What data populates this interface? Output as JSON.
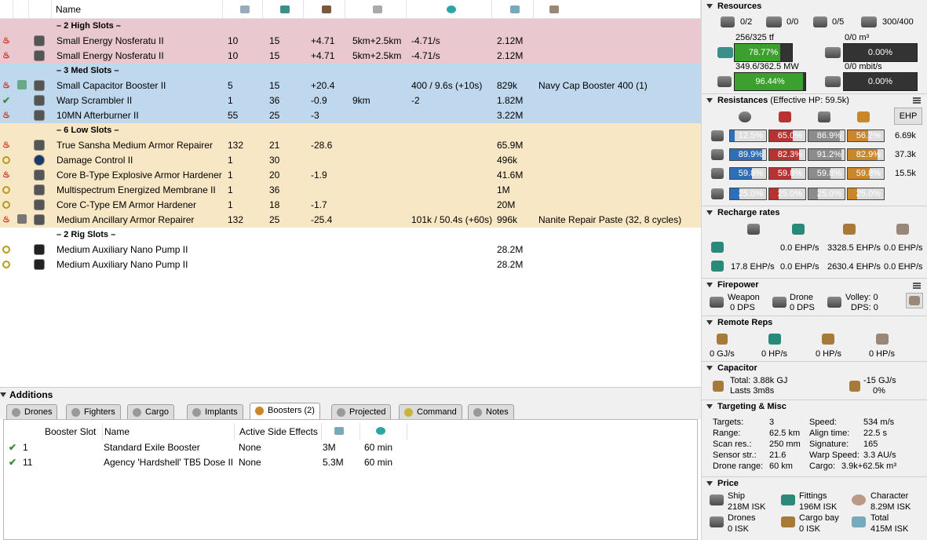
{
  "fitting": {
    "columns": {
      "name": "Name"
    },
    "sections": [
      {
        "kind": "high",
        "title": "– 2 High Slots –"
      },
      {
        "kind": "med",
        "title": "– 3 Med Slots –"
      },
      {
        "kind": "low",
        "title": "– 6 Low Slots –"
      },
      {
        "kind": "rig",
        "title": "– 2 Rig Slots –"
      }
    ],
    "rows": [
      {
        "name": "Small Energy Nosferatu II",
        "c1": "10",
        "c2": "15",
        "c3": "+4.71",
        "c4": "5km+2.5km",
        "c5": "-4.71/s",
        "c6": "2.12M",
        "c7": ""
      },
      {
        "name": "Small Energy Nosferatu II",
        "c1": "10",
        "c2": "15",
        "c3": "+4.71",
        "c4": "5km+2.5km",
        "c5": "-4.71/s",
        "c6": "2.12M",
        "c7": ""
      },
      {
        "name": "Small Capacitor Booster II",
        "c1": "5",
        "c2": "15",
        "c3": "+20.4",
        "c4": "",
        "c5": "400 / 9.6s (+10s)",
        "c6": "829k",
        "c7": "Navy Cap Booster 400 (1)"
      },
      {
        "name": "Warp Scrambler II",
        "c1": "1",
        "c2": "36",
        "c3": "-0.9",
        "c4": "9km",
        "c5": "-2",
        "c6": "1.82M",
        "c7": ""
      },
      {
        "name": "10MN Afterburner II",
        "c1": "55",
        "c2": "25",
        "c3": "-3",
        "c4": "",
        "c5": "",
        "c6": "3.22M",
        "c7": ""
      },
      {
        "name": "True Sansha Medium Armor Repairer",
        "c1": "132",
        "c2": "21",
        "c3": "-28.6",
        "c4": "",
        "c5": "",
        "c6": "65.9M",
        "c7": ""
      },
      {
        "name": "Damage Control II",
        "c1": "1",
        "c2": "30",
        "c3": "",
        "c4": "",
        "c5": "",
        "c6": "496k",
        "c7": ""
      },
      {
        "name": "Core B-Type Explosive Armor Hardener",
        "c1": "1",
        "c2": "20",
        "c3": "-1.9",
        "c4": "",
        "c5": "",
        "c6": "41.6M",
        "c7": ""
      },
      {
        "name": "Multispectrum Energized Membrane II",
        "c1": "1",
        "c2": "36",
        "c3": "",
        "c4": "",
        "c5": "",
        "c6": "1M",
        "c7": ""
      },
      {
        "name": "Core C-Type EM Armor Hardener",
        "c1": "1",
        "c2": "18",
        "c3": "-1.7",
        "c4": "",
        "c5": "",
        "c6": "20M",
        "c7": ""
      },
      {
        "name": "Medium Ancillary Armor Repairer",
        "c1": "132",
        "c2": "25",
        "c3": "-25.4",
        "c4": "",
        "c5": "101k / 50.4s (+60s)",
        "c6": "996k",
        "c7": "Nanite Repair Paste (32, 8 cycles)"
      },
      {
        "name": "Medium Auxiliary Nano Pump II",
        "c1": "",
        "c2": "",
        "c3": "",
        "c4": "",
        "c5": "",
        "c6": "28.2M",
        "c7": ""
      },
      {
        "name": "Medium Auxiliary Nano Pump II",
        "c1": "",
        "c2": "",
        "c3": "",
        "c4": "",
        "c5": "",
        "c6": "28.2M",
        "c7": ""
      }
    ]
  },
  "additions": {
    "title": "Additions",
    "tabs": [
      "Drones",
      "Fighters",
      "Cargo",
      "Implants",
      "Boosters (2)",
      "Projected",
      "Command",
      "Notes"
    ],
    "headers": [
      "Booster Slot",
      "Name",
      "Active Side Effects"
    ],
    "rows": [
      {
        "slot": "1",
        "name": "Standard Exile Booster",
        "effects": "None",
        "price": "3M",
        "duration": "60 min"
      },
      {
        "slot": "11",
        "name": "Agency 'Hardshell' TB5 Dose II",
        "effects": "None",
        "price": "5.3M",
        "duration": "60 min"
      }
    ]
  },
  "resources": {
    "title": "Resources",
    "hardpoints": [
      "0/2",
      "0/0",
      "0/5",
      "300/400"
    ],
    "cpu_text": "256/325 tf",
    "cpu_pct": "78.77%",
    "cpu_fill": 0.7877,
    "drone_bay": "0/0 m³",
    "drone_bay_pct": "0.00%",
    "power_text": "349.6/362.5 MW",
    "power_pct": "96.44%",
    "power_fill": 0.9644,
    "bandwidth": "0/0 mbit/s",
    "bandwidth_pct": "0.00%"
  },
  "resistances": {
    "title": "Resistances",
    "subtitle": "(Effective HP: 59.5k)",
    "ehp_button": "EHP",
    "rows": [
      {
        "vals": [
          "12.5%",
          "65.0%",
          "86.9%",
          "56.2%"
        ],
        "fills": [
          0.125,
          0.65,
          0.869,
          0.562
        ],
        "ehp": "6.69k"
      },
      {
        "vals": [
          "89.9%",
          "82.3%",
          "91.2%",
          "82.9%"
        ],
        "fills": [
          0.899,
          0.823,
          0.912,
          0.829
        ],
        "ehp": "37.3k"
      },
      {
        "vals": [
          "59.8%",
          "59.8%",
          "59.8%",
          "59.8%"
        ],
        "fills": [
          0.598,
          0.598,
          0.598,
          0.598
        ],
        "ehp": "15.5k"
      },
      {
        "vals": [
          "25.0%",
          "25.0%",
          "25.0%",
          "25.0%"
        ],
        "fills": [
          0.25,
          0.25,
          0.25,
          0.25
        ],
        "ehp": ""
      }
    ],
    "colors": [
      "#2f6fb5",
      "#b83232",
      "#8c8c8c",
      "#c9872a"
    ]
  },
  "recharge": {
    "title": "Recharge rates",
    "row1": [
      "0.0 EHP/s",
      "3328.5 EHP/s",
      "0.0 EHP/s"
    ],
    "row2": [
      "17.8 EHP/s",
      "0.0 EHP/s",
      "2630.4 EHP/s",
      "0.0 EHP/s"
    ]
  },
  "firepower": {
    "title": "Firepower",
    "weapon_label": "Weapon",
    "weapon_dps": "0 DPS",
    "drone_label": "Drone",
    "drone_dps": "0 DPS",
    "volley": "Volley: 0",
    "dps": "DPS: 0"
  },
  "remote_reps": {
    "title": "Remote Reps",
    "values": [
      "0 GJ/s",
      "0 HP/s",
      "0 HP/s",
      "0 HP/s"
    ]
  },
  "capacitor": {
    "title": "Capacitor",
    "total": "Total: 3.88k GJ",
    "lasts": "Lasts 3m8s",
    "delta": "-15 GJ/s",
    "pct": "0%"
  },
  "targeting": {
    "title": "Targeting & Misc",
    "left": [
      [
        "Targets:",
        "3"
      ],
      [
        "Range:",
        "62.5 km"
      ],
      [
        "Scan res.:",
        "250 mm"
      ],
      [
        "Sensor str.:",
        "21.6"
      ],
      [
        "Drone range:",
        "60 km"
      ]
    ],
    "right": [
      [
        "Speed:",
        "534 m/s"
      ],
      [
        "Align time:",
        "22.5 s"
      ],
      [
        "Signature:",
        "165"
      ],
      [
        "Warp Speed:",
        "3.3 AU/s"
      ],
      [
        "Cargo:",
        "3.9k+62.5k m³"
      ]
    ]
  },
  "price": {
    "title": "Price",
    "items": [
      {
        "label": "Ship",
        "value": "218M ISK"
      },
      {
        "label": "Fittings",
        "value": "196M ISK"
      },
      {
        "label": "Character",
        "value": "8.29M ISK"
      },
      {
        "label": "Drones",
        "value": "0 ISK"
      },
      {
        "label": "Cargo bay",
        "value": "0 ISK"
      },
      {
        "label": "Total",
        "value": "415M ISK"
      }
    ]
  }
}
